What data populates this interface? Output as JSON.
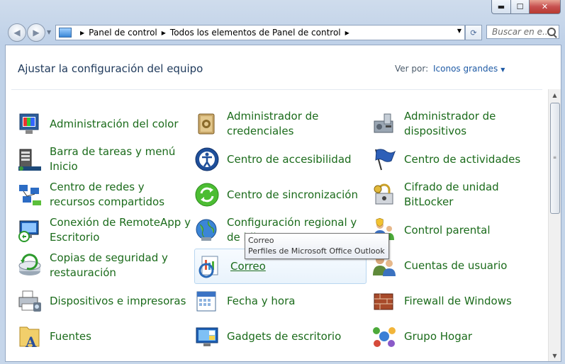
{
  "window": {
    "min_label": "▬",
    "max_label": "☐",
    "close_label": "✕"
  },
  "nav": {
    "back_icon": "◀",
    "forward_icon": "▶",
    "history_icon": "▼"
  },
  "address": {
    "crumbs": [
      "Panel de control",
      "Todos los elementos de Panel de control"
    ],
    "dropdown_icon": "▼",
    "refresh_icon": "⟳"
  },
  "search": {
    "placeholder": "Buscar en e..."
  },
  "header": {
    "title": "Ajustar la configuración del equipo",
    "view_by_label": "Ver por:",
    "view_by_value": "Iconos grandes"
  },
  "items": [
    {
      "label": "Administración del color",
      "icon": "color-management-icon"
    },
    {
      "label": "Administrador de credenciales",
      "icon": "credential-manager-icon"
    },
    {
      "label": "Administrador de dispositivos",
      "icon": "device-manager-icon"
    },
    {
      "label": "Barra de tareas y menú Inicio",
      "icon": "taskbar-icon"
    },
    {
      "label": "Centro de accesibilidad",
      "icon": "accessibility-icon"
    },
    {
      "label": "Centro de actividades",
      "icon": "action-center-flag-icon"
    },
    {
      "label": "Centro de redes y recursos compartidos",
      "icon": "network-icon"
    },
    {
      "label": "Centro de sincronización",
      "icon": "sync-icon"
    },
    {
      "label": "Cifrado de unidad BitLocker",
      "icon": "bitlocker-icon"
    },
    {
      "label": "Conexión de RemoteApp y Escritorio",
      "icon": "remoteapp-icon"
    },
    {
      "label": "Configuración regional y de idioma",
      "icon": "region-globe-icon"
    },
    {
      "label": "Control parental",
      "icon": "parental-control-icon"
    },
    {
      "label": "Copias de seguridad y restauración",
      "icon": "backup-icon"
    },
    {
      "label": "Correo",
      "icon": "mail-icon"
    },
    {
      "label": "Cuentas de usuario",
      "icon": "user-accounts-icon"
    },
    {
      "label": "Dispositivos e impresoras",
      "icon": "printer-icon"
    },
    {
      "label": "Fecha y hora",
      "icon": "date-time-icon"
    },
    {
      "label": "Firewall de Windows",
      "icon": "firewall-icon"
    },
    {
      "label": "Fuentes",
      "icon": "fonts-icon"
    },
    {
      "label": "Gadgets de escritorio",
      "icon": "gadgets-icon"
    },
    {
      "label": "Grupo Hogar",
      "icon": "homegroup-icon"
    }
  ],
  "tooltip": {
    "title": "Correo",
    "text": "Perfiles de Microsoft Office Outlook"
  },
  "scrollbar": {
    "up_icon": "▲",
    "down_icon": "▼",
    "grip": "≡"
  },
  "colors": {
    "link_green": "#1b6b1b",
    "heading": "#1e395b",
    "accent_blue": "#1e5aa5"
  }
}
